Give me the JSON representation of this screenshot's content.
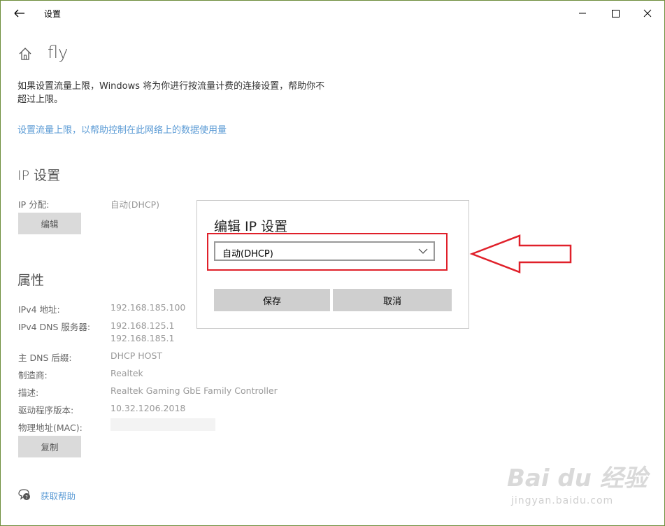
{
  "window": {
    "title": "设置"
  },
  "header": {
    "page_title": "fly"
  },
  "description": "如果设置流量上限，Windows 将为你进行按流量计费的连接设置，帮助你不超过上限。",
  "data_limit_link": "设置流量上限，以帮助控制在此网络上的数据使用量",
  "ip_settings": {
    "section_title": "IP 设置",
    "assignment_label": "IP 分配:",
    "assignment_value": "自动(DHCP)",
    "edit_button": "编辑"
  },
  "properties": {
    "section_title": "属性",
    "rows": [
      {
        "label": "IPv4 地址:",
        "value": "192.168.185.100"
      },
      {
        "label": "IPv4 DNS 服务器:",
        "value": "192.168.125.1"
      },
      {
        "label": "",
        "value": "192.168.185.1"
      },
      {
        "label": "主 DNS 后缀:",
        "value": "DHCP HOST"
      },
      {
        "label": "制造商:",
        "value": "Realtek"
      },
      {
        "label": "描述:",
        "value": "Realtek Gaming GbE Family Controller"
      },
      {
        "label": "驱动程序版本:",
        "value": "10.32.1206.2018"
      },
      {
        "label": "物理地址(MAC):",
        "value": ""
      }
    ],
    "copy_button": "复制"
  },
  "help": {
    "label": "获取帮助"
  },
  "dialog": {
    "title": "编辑 IP 设置",
    "select_value": "自动(DHCP)",
    "save_button": "保存",
    "cancel_button": "取消"
  },
  "watermark": {
    "main": "Bai du 经验",
    "sub": "jingyan.baidu.com"
  },
  "colors": {
    "link": "#5b9bd5",
    "highlight": "#e0202a",
    "button": "#dadada"
  }
}
